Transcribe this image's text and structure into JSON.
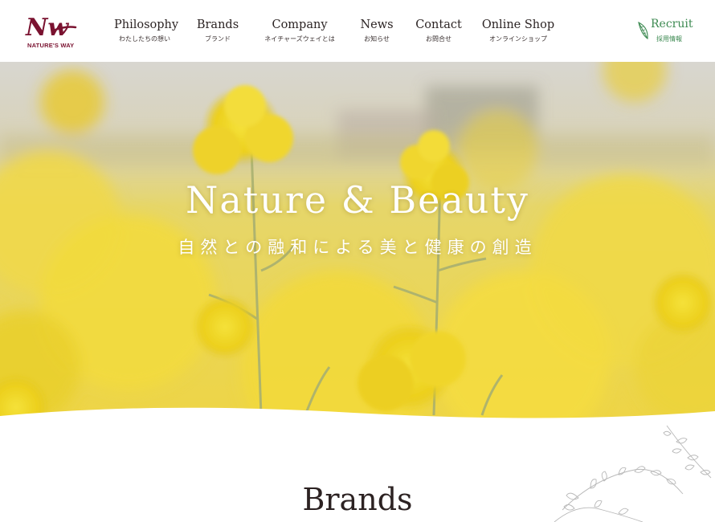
{
  "header": {
    "logo": {
      "mark": "Nw",
      "text": "NATURE'S WAY",
      "color": "#7a1230"
    },
    "nav": [
      {
        "en": "Philosophy",
        "ja": "わたしたちの想い"
      },
      {
        "en": "Brands",
        "ja": "ブランド"
      },
      {
        "en": "Company",
        "ja": "ネイチャーズウェイとは"
      },
      {
        "en": "News",
        "ja": "お知らせ"
      },
      {
        "en": "Contact",
        "ja": "お問合せ"
      },
      {
        "en": "Online Shop",
        "ja": "オンラインショップ"
      }
    ],
    "recruit": {
      "en": "Recruit",
      "ja": "採用情報",
      "icon": "leaf-icon",
      "color": "#3d8a52"
    }
  },
  "hero": {
    "title": "Nature & Beauty",
    "subtitle": "自然との融和による美と健康の創造"
  },
  "brands": {
    "title": "Brands"
  }
}
